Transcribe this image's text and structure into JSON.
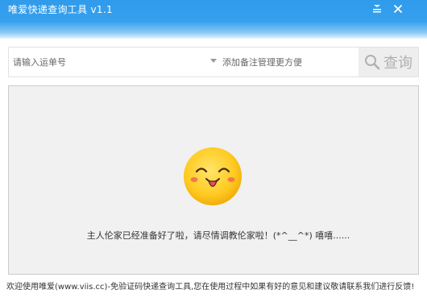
{
  "window": {
    "title": "唯爱快递查询工具 v1.1"
  },
  "search": {
    "tracking_placeholder": "请输入运单号",
    "note_placeholder": "添加备注管理更方便",
    "query_label": "查询"
  },
  "main": {
    "status_message": "主人伦家已经准备好了啦，请尽情调教伦家啦！(*^__^*) 嘻嘻......"
  },
  "footer": {
    "text": "欢迎使用唯爱(www.viis.cc)-免验证码快递查询工具,您在使用过程中如果有好的意见和建议敬请联系我们进行反馈!"
  },
  "icons": {
    "menu": "menu-icon",
    "close": "close-icon",
    "search": "search-icon",
    "dropdown": "dropdown-arrow-icon",
    "smiley": "smiley-face-icon"
  },
  "colors": {
    "titlebar": "#2f9bea",
    "panel_bg": "#f1f1f1",
    "smiley_face": "#ffc21c",
    "button_bg": "#eeeeee"
  }
}
